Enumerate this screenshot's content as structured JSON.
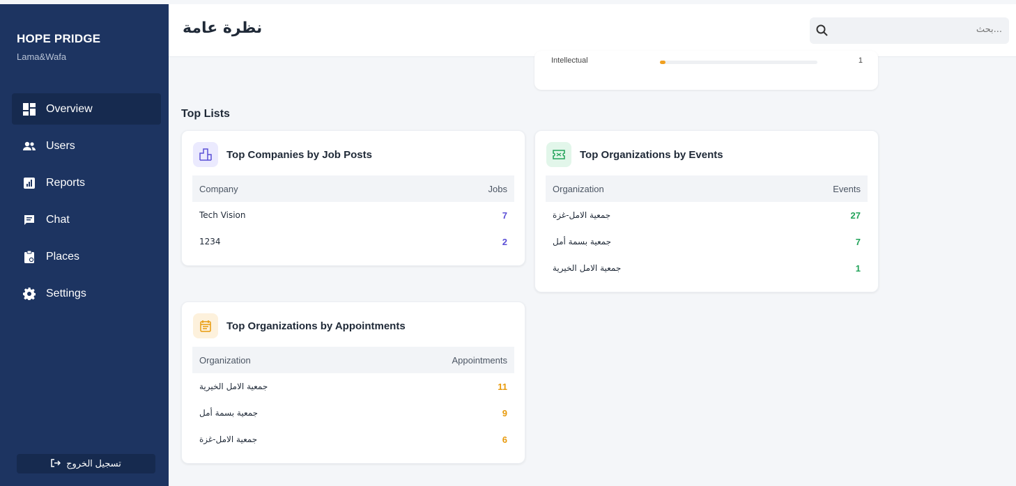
{
  "sidebar": {
    "brand": "HOPE PRIDGE",
    "subtitle": "Lama&Wafa",
    "items": [
      {
        "label": "Overview",
        "icon": "dashboard-icon",
        "active": true
      },
      {
        "label": "Users",
        "icon": "users-icon"
      },
      {
        "label": "Reports",
        "icon": "reports-icon"
      },
      {
        "label": "Chat",
        "icon": "chat-icon"
      },
      {
        "label": "Places",
        "icon": "clipboard-icon"
      },
      {
        "label": "Settings",
        "icon": "gear-icon"
      }
    ],
    "logout_label": "تسجيل الخروج"
  },
  "header": {
    "title": "نظرة عامة",
    "search_placeholder": "...بحث"
  },
  "prev_card": {
    "label": "Intellectual",
    "value": "1"
  },
  "section_title": "Top Lists",
  "cards": {
    "companies": {
      "title": "Top Companies by Job Posts",
      "icon": "building-icon",
      "col1": "Company",
      "col2": "Jobs",
      "value_color": "#5b4fd6",
      "rows": [
        {
          "name": "Tech Vision",
          "value": "7"
        },
        {
          "name": "1234",
          "value": "2"
        }
      ]
    },
    "events": {
      "title": "Top Organizations by Events",
      "icon": "ticket-icon",
      "col1": "Organization",
      "col2": "Events",
      "value_color": "#22a35a",
      "rows": [
        {
          "name": "جمعية الامل-غزة",
          "value": "27"
        },
        {
          "name": "جمعية بسمة أمل",
          "value": "7"
        },
        {
          "name": "جمعية الامل الخيرية",
          "value": "1"
        }
      ]
    },
    "appointments": {
      "title": "Top Organizations by Appointments",
      "icon": "calendar-icon",
      "col1": "Organization",
      "col2": "Appointments",
      "value_color": "#e89a0c",
      "rows": [
        {
          "name": "جمعية الامل الخيرية",
          "value": "11"
        },
        {
          "name": "جمعية بسمة أمل",
          "value": "9"
        },
        {
          "name": "جمعية الامل-غزة",
          "value": "6"
        }
      ]
    }
  }
}
